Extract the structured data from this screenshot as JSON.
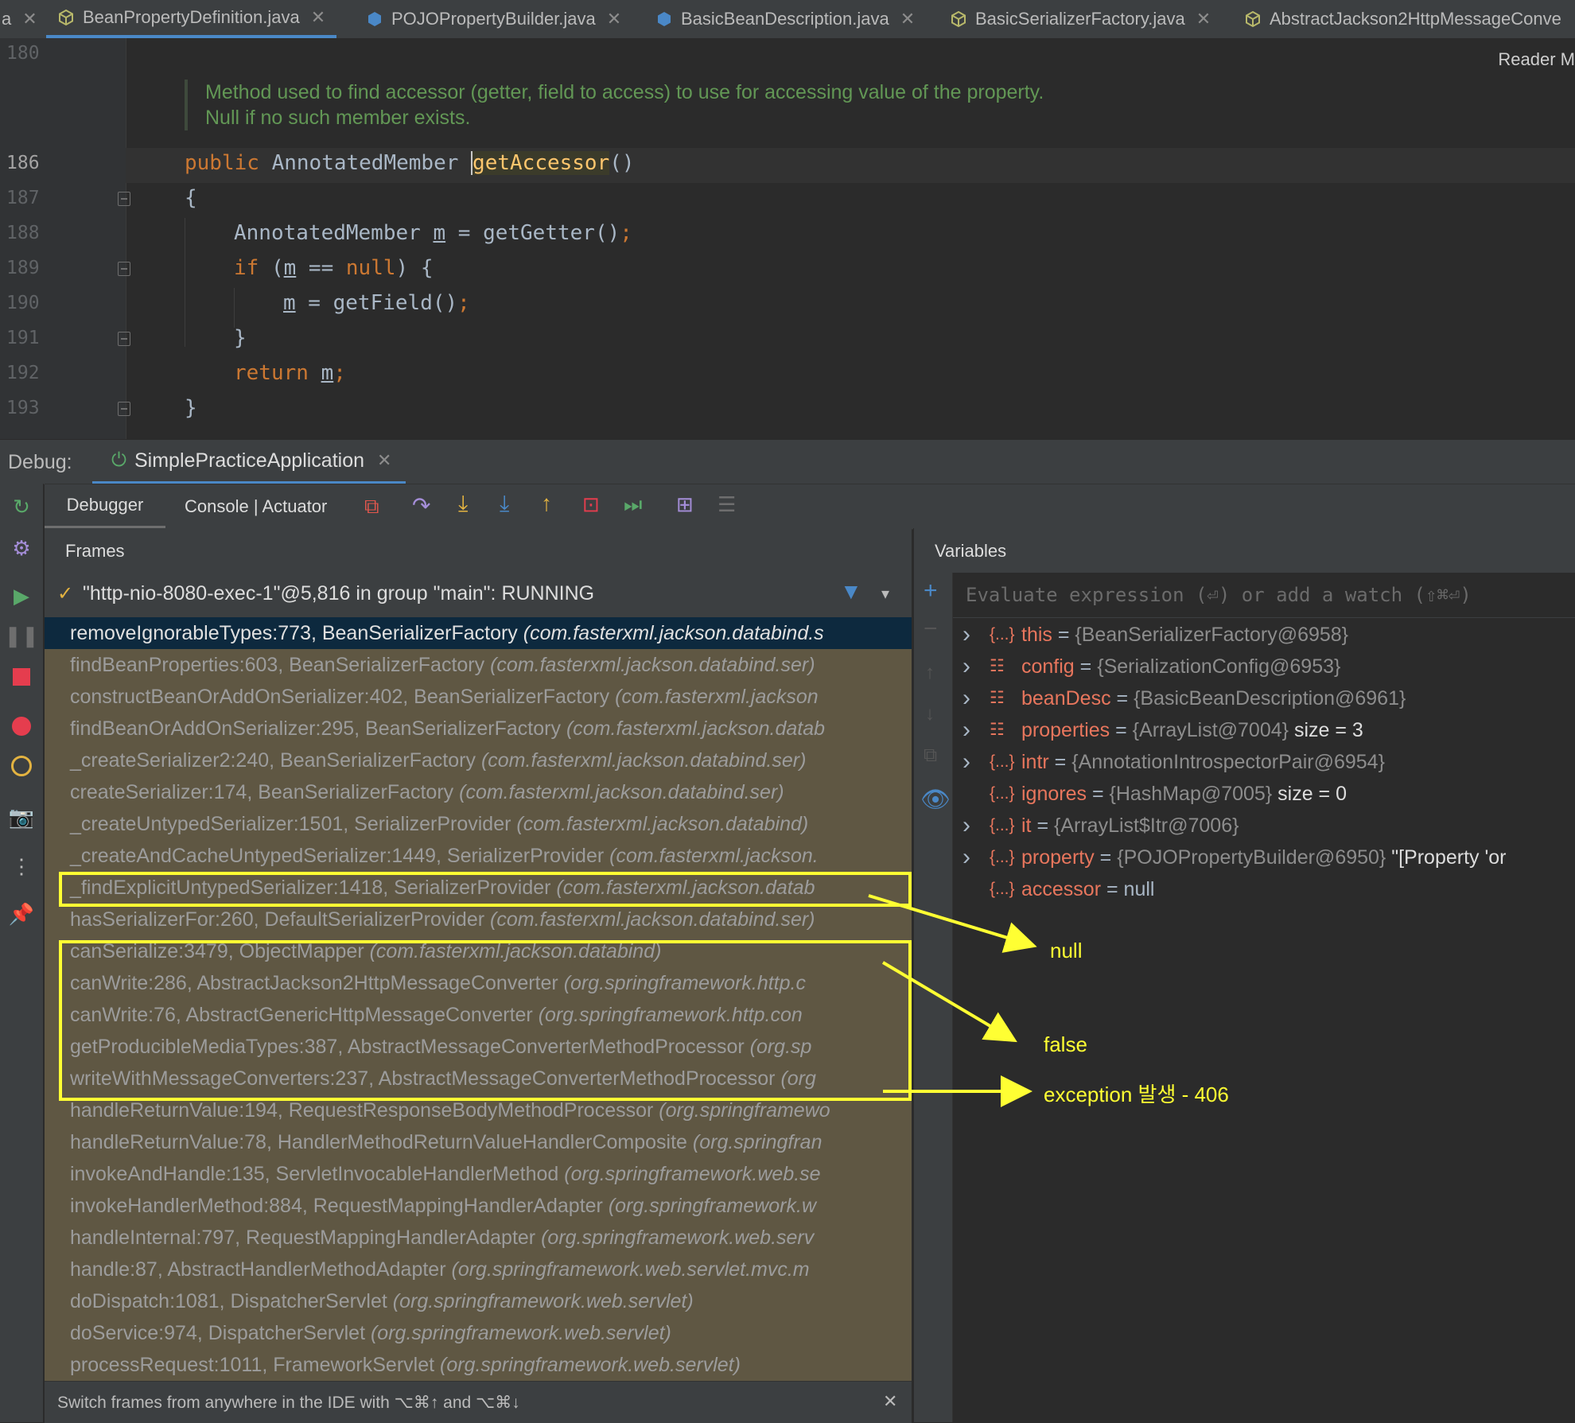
{
  "tabs": [
    {
      "label": "a",
      "active": false
    },
    {
      "label": "BeanPropertyDefinition.java",
      "active": true
    },
    {
      "label": "POJOPropertyBuilder.java",
      "active": false
    },
    {
      "label": "BasicBeanDescription.java",
      "active": false
    },
    {
      "label": "BasicSerializerFactory.java",
      "active": false
    },
    {
      "label": "AbstractJackson2HttpMessageConve",
      "active": false
    }
  ],
  "editor": {
    "reader_mode": "Reader M",
    "doc_line1": "Method used to find accessor (getter, field to access) to use for accessing value of the property.",
    "doc_line2": "Null if no such member exists.",
    "line_numbers": [
      "180",
      "186",
      "187",
      "188",
      "189",
      "190",
      "191",
      "192",
      "193"
    ],
    "code": {
      "l186_kw": "public",
      "l186_type": "AnnotatedMember",
      "l186_fn": "getAccessor",
      "l186_parens": "()",
      "l187": "{",
      "l188_a": "AnnotatedMember ",
      "l188_m": "m",
      "l188_b": " = getGetter()",
      "l188_semi": ";",
      "l189_if": "if",
      "l189_a": " (",
      "l189_m": "m",
      "l189_b": " == ",
      "l189_null": "null",
      "l189_c": ") {",
      "l190_m": "m",
      "l190_b": " = getField()",
      "l190_semi": ";",
      "l191": "}",
      "l192_ret": "return",
      "l192_m": "m",
      "l192_semi": ";",
      "l193": "}"
    }
  },
  "debug": {
    "label": "Debug:",
    "session": "SimplePracticeApplication",
    "tab_debugger": "Debugger",
    "tab_console": "Console | Actuator",
    "frames_title": "Frames",
    "variables_title": "Variables",
    "thread": "\"http-nio-8080-exec-1\"@5,816 in group \"main\": RUNNING",
    "eval_placeholder": "Evaluate expression (⏎) or add a watch (⇧⌘⏎)",
    "footer_hint": "Switch frames from anywhere in the IDE with ⌥⌘↑ and ⌥⌘↓"
  },
  "frames": [
    {
      "method": "removeIgnorableTypes:773, BeanSerializerFactory",
      "pkg": "(com.fasterxml.jackson.databind.s"
    },
    {
      "method": "findBeanProperties:603, BeanSerializerFactory",
      "pkg": "(com.fasterxml.jackson.databind.ser)"
    },
    {
      "method": "constructBeanOrAddOnSerializer:402, BeanSerializerFactory",
      "pkg": "(com.fasterxml.jackson"
    },
    {
      "method": "findBeanOrAddOnSerializer:295, BeanSerializerFactory",
      "pkg": "(com.fasterxml.jackson.datab"
    },
    {
      "method": "_createSerializer2:240, BeanSerializerFactory",
      "pkg": "(com.fasterxml.jackson.databind.ser)"
    },
    {
      "method": "createSerializer:174, BeanSerializerFactory",
      "pkg": "(com.fasterxml.jackson.databind.ser)"
    },
    {
      "method": "_createUntypedSerializer:1501, SerializerProvider",
      "pkg": "(com.fasterxml.jackson.databind)"
    },
    {
      "method": "_createAndCacheUntypedSerializer:1449, SerializerProvider",
      "pkg": "(com.fasterxml.jackson."
    },
    {
      "method": "_findExplicitUntypedSerializer:1418, SerializerProvider",
      "pkg": "(com.fasterxml.jackson.datab"
    },
    {
      "method": "hasSerializerFor:260, DefaultSerializerProvider",
      "pkg": "(com.fasterxml.jackson.databind.ser)"
    },
    {
      "method": "canSerialize:3479, ObjectMapper",
      "pkg": "(com.fasterxml.jackson.databind)"
    },
    {
      "method": "canWrite:286, AbstractJackson2HttpMessageConverter",
      "pkg": "(org.springframework.http.c"
    },
    {
      "method": "canWrite:76, AbstractGenericHttpMessageConverter",
      "pkg": "(org.springframework.http.con"
    },
    {
      "method": "getProducibleMediaTypes:387, AbstractMessageConverterMethodProcessor",
      "pkg": "(org.sp"
    },
    {
      "method": "writeWithMessageConverters:237, AbstractMessageConverterMethodProcessor",
      "pkg": "(org"
    },
    {
      "method": "handleReturnValue:194, RequestResponseBodyMethodProcessor",
      "pkg": "(org.springframewo"
    },
    {
      "method": "handleReturnValue:78, HandlerMethodReturnValueHandlerComposite",
      "pkg": "(org.springfran"
    },
    {
      "method": "invokeAndHandle:135, ServletInvocableHandlerMethod",
      "pkg": "(org.springframework.web.se"
    },
    {
      "method": "invokeHandlerMethod:884, RequestMappingHandlerAdapter",
      "pkg": "(org.springframework.w"
    },
    {
      "method": "handleInternal:797, RequestMappingHandlerAdapter",
      "pkg": "(org.springframework.web.serv"
    },
    {
      "method": "handle:87, AbstractHandlerMethodAdapter",
      "pkg": "(org.springframework.web.servlet.mvc.m"
    },
    {
      "method": "doDispatch:1081, DispatcherServlet",
      "pkg": "(org.springframework.web.servlet)"
    },
    {
      "method": "doService:974, DispatcherServlet",
      "pkg": "(org.springframework.web.servlet)"
    },
    {
      "method": "processRequest:1011, FrameworkServlet",
      "pkg": "(org.springframework.web.servlet)"
    }
  ],
  "variables": [
    {
      "name": "this",
      "value": "{BeanSerializerFactory@6958}",
      "extra": "",
      "icon": "{...}",
      "expandable": true
    },
    {
      "name": "config",
      "value": "{SerializationConfig@6953}",
      "extra": "",
      "icon": "☷",
      "expandable": true
    },
    {
      "name": "beanDesc",
      "value": "{BasicBeanDescription@6961}",
      "extra": "",
      "icon": "☷",
      "expandable": true
    },
    {
      "name": "properties",
      "value": "{ArrayList@7004}",
      "extra": "size = 3",
      "icon": "☷",
      "expandable": true
    },
    {
      "name": "intr",
      "value": "{AnnotationIntrospectorPair@6954}",
      "extra": "",
      "icon": "{...}",
      "expandable": true
    },
    {
      "name": "ignores",
      "value": "{HashMap@7005}",
      "extra": "size = 0",
      "icon": "{...}",
      "expandable": false
    },
    {
      "name": "it",
      "value": "{ArrayList$Itr@7006}",
      "extra": "",
      "icon": "{...}",
      "expandable": true
    },
    {
      "name": "property",
      "value": "{POJOPropertyBuilder@6950}",
      "extra": "\"[Property 'or",
      "icon": "{...}",
      "expandable": true
    },
    {
      "name": "accessor",
      "value": "null",
      "extra": "",
      "icon": "{...}",
      "expandable": false
    }
  ],
  "annotations": {
    "null_label": "null",
    "false_label": "false",
    "exception_label": "exception  발생 - 406"
  },
  "colors": {
    "accent": "#4a88c7",
    "highlight": "#ffff33",
    "frames_bg": "#5f5743",
    "selected_frame": "#0d293e"
  }
}
